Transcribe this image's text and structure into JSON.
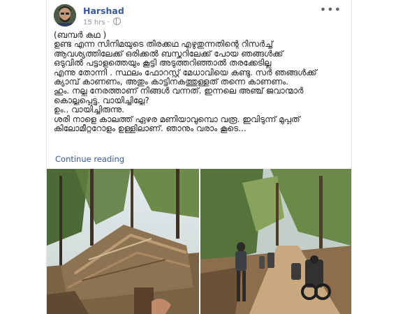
{
  "post": {
    "author": "Harshad",
    "time": "15 hrs",
    "dot": "·",
    "more": "•••",
    "lines": [
      "(ബമ്പർ കഥ )",
      "ഉണ്ട എന്ന സിനിമയുടെ തിരക്കഥ എഴുതുന്നതിന്റെ റിസർച്ച്",
      "ആവശ്യത്തിലേക്ക് ഒരിക്കൽ ബസ്തറിലേക്ക് പോയ ഞങ്ങൾക്ക്",
      "ഒടുവിൽ പട്ടാളത്തെയും കൂട്ടി അടുത്തറിഞ്ഞാൽ തരക്കേടില്ല",
      "എന്നു തോന്നി . സ്ഥലം ഫോറസ്റ്റ് മേധാവിയെ കണ്ടു. സർ ഞങ്ങൾക്ക്",
      "ക്യാമ്പ് കാണണം, അതും കാട്ടിനകത്തുള്ളത് തന്നെ കാണണം.",
      "ഹും. നല്ല നേരത്താണ് നിങ്ങൾ വന്നത്. ഇന്നലെ അഞ്ച് ജവാന്മാർ",
      "കൊല്ലപ്പെട്ടു. വായിച്ചില്ലേ?",
      "ഉം.. വായിച്ചിരുന്നു.",
      "ശരി നാളെ കാലത്ത് ഏഴര മണിയാവുമ്പൊ വരൂ. ഇവിടുന്ന് മുപ്പത്",
      "കിലോമീറ്ററോളം ഉള്ളിലാണ്. ഞാനും വരാം കൂടെ..."
    ],
    "continue_label": "Continue reading"
  },
  "colors": {
    "name": "#385898",
    "link": "#365899",
    "meta": "#90949c",
    "text": "#1c1e21"
  },
  "icons": {
    "privacy": "globe-icon",
    "options": "more-options-icon"
  },
  "photos": [
    {
      "description_icon": "hut-photo"
    },
    {
      "description_icon": "forest-road-photo"
    }
  ]
}
